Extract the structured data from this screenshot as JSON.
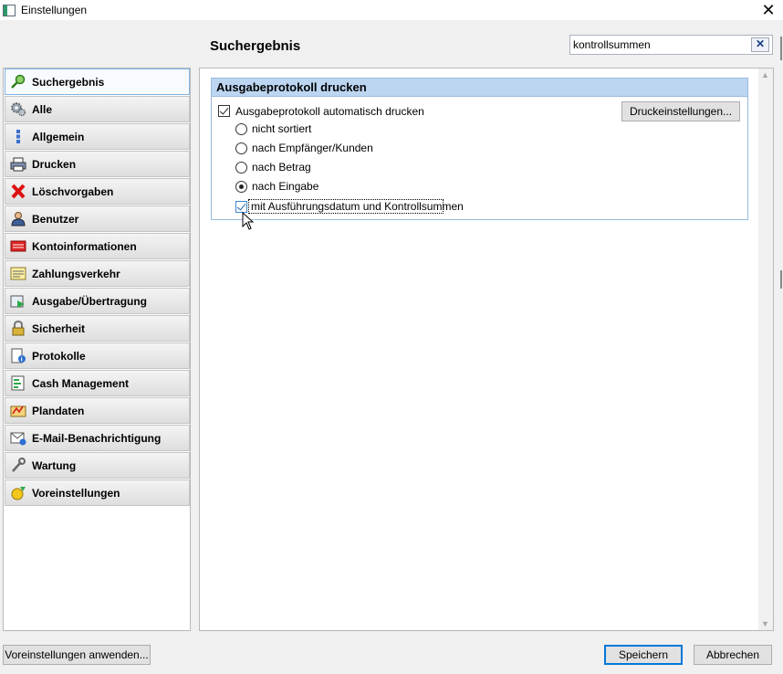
{
  "window": {
    "title": "Einstellungen",
    "close_glyph": "✕"
  },
  "header": {
    "title": "Suchergebnis"
  },
  "search": {
    "value": "kontrollsummen",
    "clear_glyph": "✕"
  },
  "sidebar": {
    "items": [
      {
        "label": "Suchergebnis",
        "icon": "magnifier-icon",
        "active": true
      },
      {
        "label": "Alle",
        "icon": "gear-icon"
      },
      {
        "label": "Allgemein",
        "icon": "info-icon"
      },
      {
        "label": "Drucken",
        "icon": "printer-icon"
      },
      {
        "label": "Löschvorgaben",
        "icon": "delete-x-icon"
      },
      {
        "label": "Benutzer",
        "icon": "user-icon"
      },
      {
        "label": "Kontoinformationen",
        "icon": "account-icon"
      },
      {
        "label": "Zahlungsverkehr",
        "icon": "payment-icon"
      },
      {
        "label": "Ausgabe/Übertragung",
        "icon": "transfer-icon"
      },
      {
        "label": "Sicherheit",
        "icon": "lock-icon"
      },
      {
        "label": "Protokolle",
        "icon": "log-icon"
      },
      {
        "label": "Cash Management",
        "icon": "cash-icon"
      },
      {
        "label": "Plandaten",
        "icon": "plan-icon"
      },
      {
        "label": "E-Mail-Benachrichtigung",
        "icon": "mail-icon"
      },
      {
        "label": "Wartung",
        "icon": "wrench-icon"
      },
      {
        "label": "Voreinstellungen",
        "icon": "preset-icon"
      }
    ]
  },
  "section": {
    "title": "Ausgabeprotokoll drucken",
    "auto_print": {
      "label": "Ausgabeprotokoll automatisch drucken",
      "checked": true
    },
    "print_settings_button": "Druckeinstellungen...",
    "sort_options": [
      {
        "label": "nicht sortiert",
        "selected": false
      },
      {
        "label": "nach Empfänger/Kunden",
        "selected": false
      },
      {
        "label": "nach Betrag",
        "selected": false
      },
      {
        "label": "nach Eingabe",
        "selected": true
      }
    ],
    "with_date": {
      "label": "mit Ausführungsdatum und Kontrollsummen",
      "checked": true
    }
  },
  "footer": {
    "apply_defaults_button": "Voreinstellungen anwenden...",
    "save_button": "Speichern",
    "cancel_button": "Abbrechen"
  },
  "colors": {
    "section_header": "#bcd6f2",
    "accent": "#0078d7"
  }
}
